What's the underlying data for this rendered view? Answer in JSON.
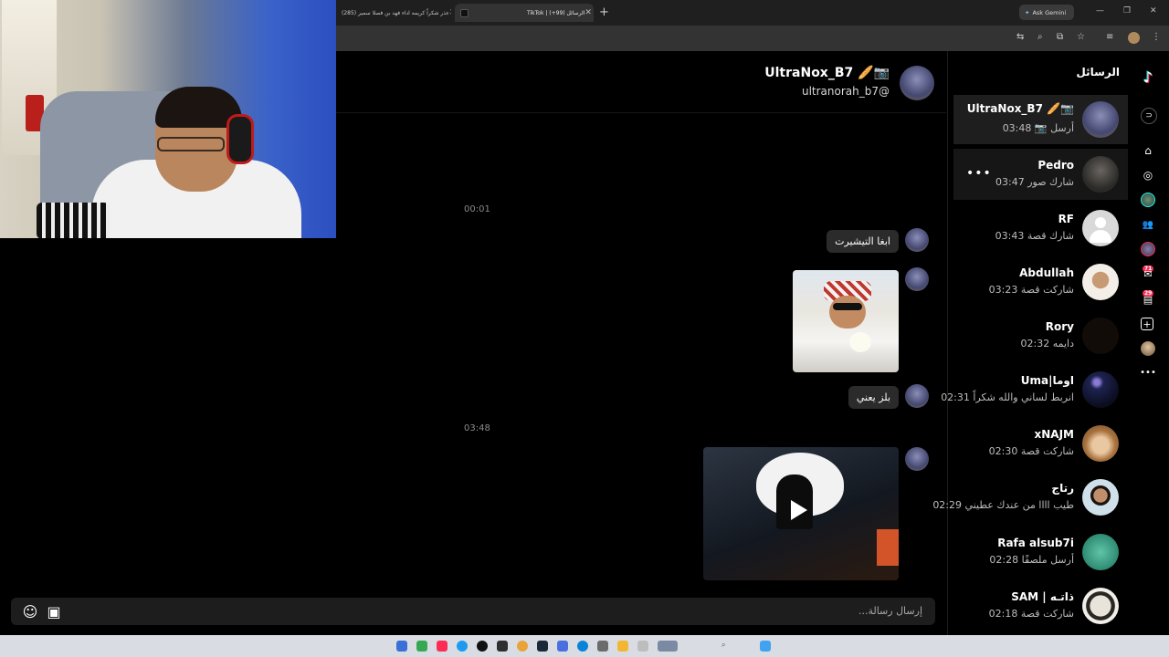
{
  "browser": {
    "tabs": [
      {
        "title": "(285) عذر شكراً كريمه اداء فهد بن فصلا سمير"
      },
      {
        "title": "TikTok | الرسائل (99+)"
      }
    ],
    "new_tab": "+",
    "gemini_label": "Ask Gemini"
  },
  "rail": {
    "badges": [
      "71",
      "29"
    ]
  },
  "inbox": {
    "title": "الرسائل",
    "conversations": [
      {
        "name": "UltraNox_B7 🥖📷",
        "preview": "أرسل 📷",
        "time": "03:48",
        "color": "#5b5f8e"
      },
      {
        "name": "Pedro",
        "preview": "شارك صور",
        "time": "03:47",
        "color": "#3b3a36"
      },
      {
        "name": "RF",
        "preview": "شارك قصة",
        "time": "03:43",
        "color": "#d9d9d9"
      },
      {
        "name": "Abdullah",
        "preview": "شاركت قصة",
        "time": "03:23",
        "color": "#e8d9c9"
      },
      {
        "name": "Rory",
        "preview": "دايمه",
        "time": "02:32",
        "color": "#120c08"
      },
      {
        "name": "Uma|اوما",
        "preview": "انربط لساني والله شكراً",
        "time": "02:31",
        "color": "#1e2350"
      },
      {
        "name": "xNAJM",
        "preview": "شاركت قصة",
        "time": "02:30",
        "color": "#c99a6e"
      },
      {
        "name": "رتاج",
        "preview": "طيب اااا من عندك عطيني",
        "time": "02:29",
        "color": "#9fb8c8"
      },
      {
        "name": "Rafa alsub7i",
        "preview": "أرسل ملصقًا",
        "time": "02:28",
        "color": "#3fa58b"
      },
      {
        "name": "SAM | ذاتـه",
        "preview": "شاركت قصة",
        "time": "02:18",
        "color": "#e7e2da"
      }
    ],
    "more": "•••"
  },
  "chat": {
    "header": {
      "name": "UltraNox_B7 🥖📷",
      "handle": "ultranorah_b7@"
    },
    "timestamps": [
      "00:01",
      "03:48"
    ],
    "messages": [
      {
        "type": "text",
        "text": "ابغا التيشيرت"
      },
      {
        "type": "image"
      },
      {
        "type": "text",
        "text": "بلز يعني"
      },
      {
        "type": "video"
      }
    ],
    "composer_placeholder": "إرسال رسالة..."
  },
  "colors": {
    "accent": "#fe2c55",
    "bubble": "#2b2b2b",
    "background": "#000000"
  }
}
